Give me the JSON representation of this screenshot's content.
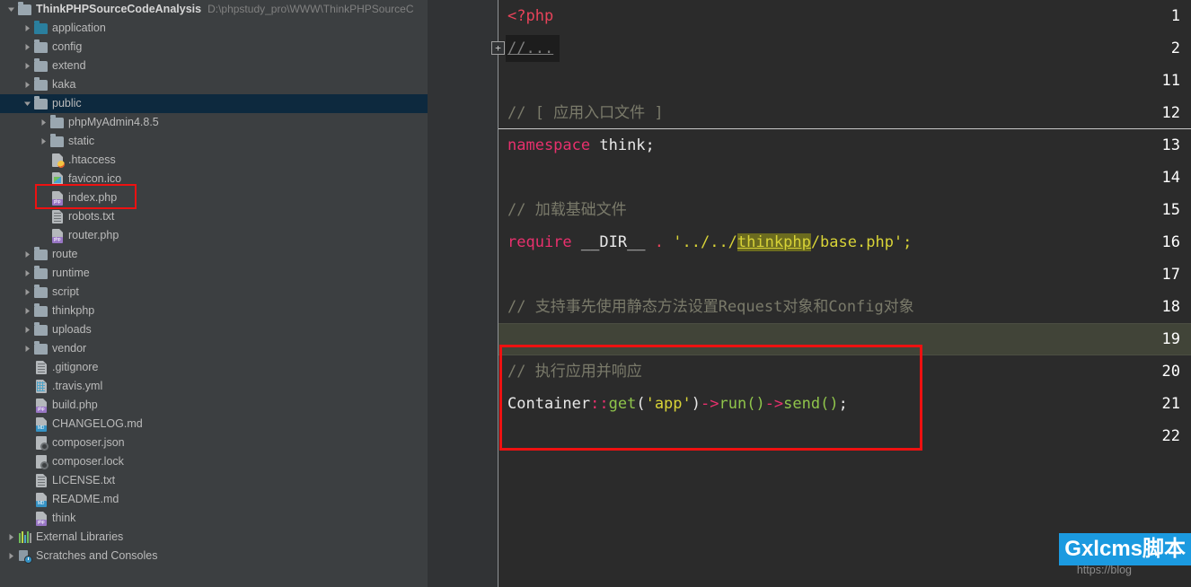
{
  "project": {
    "name": "ThinkPHPSourceCodeAnalysis",
    "path": "D:\\phpstudy_pro\\WWW\\ThinkPHPSourceC"
  },
  "tree": [
    {
      "label": "ThinkPHPSourceCodeAnalysis",
      "icon": "folder-icon",
      "indent": 0,
      "arrow": "down",
      "bold": true,
      "selected": false,
      "path": "D:\\phpstudy_pro\\WWW\\ThinkPHPSourceC"
    },
    {
      "label": "application",
      "icon": "folder-blue-icon",
      "indent": 1,
      "arrow": "right",
      "bold": false,
      "selected": false
    },
    {
      "label": "config",
      "icon": "folder-icon",
      "indent": 1,
      "arrow": "right",
      "bold": false,
      "selected": false
    },
    {
      "label": "extend",
      "icon": "folder-icon",
      "indent": 1,
      "arrow": "right",
      "bold": false,
      "selected": false
    },
    {
      "label": "kaka",
      "icon": "folder-icon",
      "indent": 1,
      "arrow": "right",
      "bold": false,
      "selected": false
    },
    {
      "label": "public",
      "icon": "folder-icon",
      "indent": 1,
      "arrow": "down",
      "bold": false,
      "selected": true
    },
    {
      "label": "phpMyAdmin4.8.5",
      "icon": "folder-icon",
      "indent": 2,
      "arrow": "right",
      "bold": false,
      "selected": false
    },
    {
      "label": "static",
      "icon": "folder-icon",
      "indent": 2,
      "arrow": "right",
      "bold": false,
      "selected": false
    },
    {
      "label": ".htaccess",
      "icon": "htaccess-file-icon",
      "indent": 2,
      "arrow": "none",
      "bold": false,
      "selected": false
    },
    {
      "label": "favicon.ico",
      "icon": "image-file-icon",
      "indent": 2,
      "arrow": "none",
      "bold": false,
      "selected": false
    },
    {
      "label": "index.php",
      "icon": "php-file-icon",
      "indent": 2,
      "arrow": "none",
      "bold": false,
      "selected": false,
      "highlighted": true
    },
    {
      "label": "robots.txt",
      "icon": "text-file-icon",
      "indent": 2,
      "arrow": "none",
      "bold": false,
      "selected": false
    },
    {
      "label": "router.php",
      "icon": "php-file-icon",
      "indent": 2,
      "arrow": "none",
      "bold": false,
      "selected": false
    },
    {
      "label": "route",
      "icon": "folder-icon",
      "indent": 1,
      "arrow": "right",
      "bold": false,
      "selected": false
    },
    {
      "label": "runtime",
      "icon": "folder-icon",
      "indent": 1,
      "arrow": "right",
      "bold": false,
      "selected": false
    },
    {
      "label": "script",
      "icon": "folder-icon",
      "indent": 1,
      "arrow": "right",
      "bold": false,
      "selected": false
    },
    {
      "label": "thinkphp",
      "icon": "folder-icon",
      "indent": 1,
      "arrow": "right",
      "bold": false,
      "selected": false
    },
    {
      "label": "uploads",
      "icon": "folder-icon",
      "indent": 1,
      "arrow": "right",
      "bold": false,
      "selected": false
    },
    {
      "label": "vendor",
      "icon": "folder-icon",
      "indent": 1,
      "arrow": "right",
      "bold": false,
      "selected": false
    },
    {
      "label": ".gitignore",
      "icon": "text-file-icon",
      "indent": 1,
      "arrow": "none",
      "bold": false,
      "selected": false
    },
    {
      "label": ".travis.yml",
      "icon": "yaml-file-icon",
      "indent": 1,
      "arrow": "none",
      "bold": false,
      "selected": false
    },
    {
      "label": "build.php",
      "icon": "php-file-icon",
      "indent": 1,
      "arrow": "none",
      "bold": false,
      "selected": false
    },
    {
      "label": "CHANGELOG.md",
      "icon": "markdown-file-icon",
      "indent": 1,
      "arrow": "none",
      "bold": false,
      "selected": false
    },
    {
      "label": "composer.json",
      "icon": "composer-file-icon",
      "indent": 1,
      "arrow": "none",
      "bold": false,
      "selected": false
    },
    {
      "label": "composer.lock",
      "icon": "composer-file-icon",
      "indent": 1,
      "arrow": "none",
      "bold": false,
      "selected": false
    },
    {
      "label": "LICENSE.txt",
      "icon": "text-file-icon",
      "indent": 1,
      "arrow": "none",
      "bold": false,
      "selected": false
    },
    {
      "label": "README.md",
      "icon": "markdown-file-icon",
      "indent": 1,
      "arrow": "none",
      "bold": false,
      "selected": false
    },
    {
      "label": "think",
      "icon": "php-file-icon",
      "indent": 1,
      "arrow": "none",
      "bold": false,
      "selected": false
    },
    {
      "label": "External Libraries",
      "icon": "libraries-icon",
      "indent": 0,
      "arrow": "right",
      "bold": false,
      "selected": false
    },
    {
      "label": "Scratches and Consoles",
      "icon": "scratches-icon",
      "indent": 0,
      "arrow": "right",
      "bold": false,
      "selected": false
    }
  ],
  "editor": {
    "fold_marker": "+",
    "current_line": 19,
    "lines": [
      {
        "no": "1",
        "kind": "php_open",
        "text": "<?php"
      },
      {
        "no": "2",
        "kind": "folded",
        "text": "//..."
      },
      {
        "no": "11",
        "kind": "blank",
        "text": ""
      },
      {
        "no": "12",
        "kind": "comment",
        "text": "// [ 应用入口文件 ]"
      },
      {
        "no": "13",
        "kind": "namespace",
        "text": "namespace think;"
      },
      {
        "no": "14",
        "kind": "blank",
        "text": ""
      },
      {
        "no": "15",
        "kind": "comment",
        "text": "// 加载基础文件"
      },
      {
        "no": "16",
        "kind": "require",
        "text": "require __DIR__ . '../../thinkphp/base.php';"
      },
      {
        "no": "17",
        "kind": "blank",
        "text": ""
      },
      {
        "no": "18",
        "kind": "comment",
        "text": "// 支持事先使用静态方法设置Request对象和Config对象"
      },
      {
        "no": "19",
        "kind": "blank",
        "text": ""
      },
      {
        "no": "20",
        "kind": "comment",
        "text": "// 执行应用并响应"
      },
      {
        "no": "21",
        "kind": "container",
        "text": "Container::get('app')->run()->send();"
      },
      {
        "no": "22",
        "kind": "blank",
        "text": ""
      }
    ],
    "tokens": {
      "php_open": "<?php",
      "folded": "//...",
      "ns_keyword": "namespace",
      "ns_name": " think;",
      "require_keyword": "require",
      "require_dir": " __DIR__ ",
      "require_dot": ".",
      "require_str_pre": " '../../",
      "require_str_hl": "thinkphp",
      "require_str_post": "/base.php';",
      "container_class": "Container",
      "container_sep": "::",
      "container_get": "get",
      "container_arg_open": "(",
      "container_arg": "'app'",
      "container_arg_close": ")",
      "container_arrow1": "->",
      "container_run": "run()",
      "container_arrow2": "->",
      "container_send": "send()",
      "container_semi": ";"
    },
    "highlight_word": "thinkphp"
  },
  "watermark": {
    "url": "https://blog",
    "badge": "Gxlcms脚本"
  },
  "colors": {
    "sidebar_bg": "#3c3f41",
    "editor_bg": "#2b2b2b",
    "gutter_bg": "#313335",
    "selection": "#0d293e",
    "annotation_red": "#ee1111",
    "keyword": "#cc7832",
    "string": "#d8d337",
    "comment": "#808080",
    "highlight_yellow": "#6b6b1f",
    "badge_blue": "#1b9ae0",
    "current_line": "#414438"
  }
}
